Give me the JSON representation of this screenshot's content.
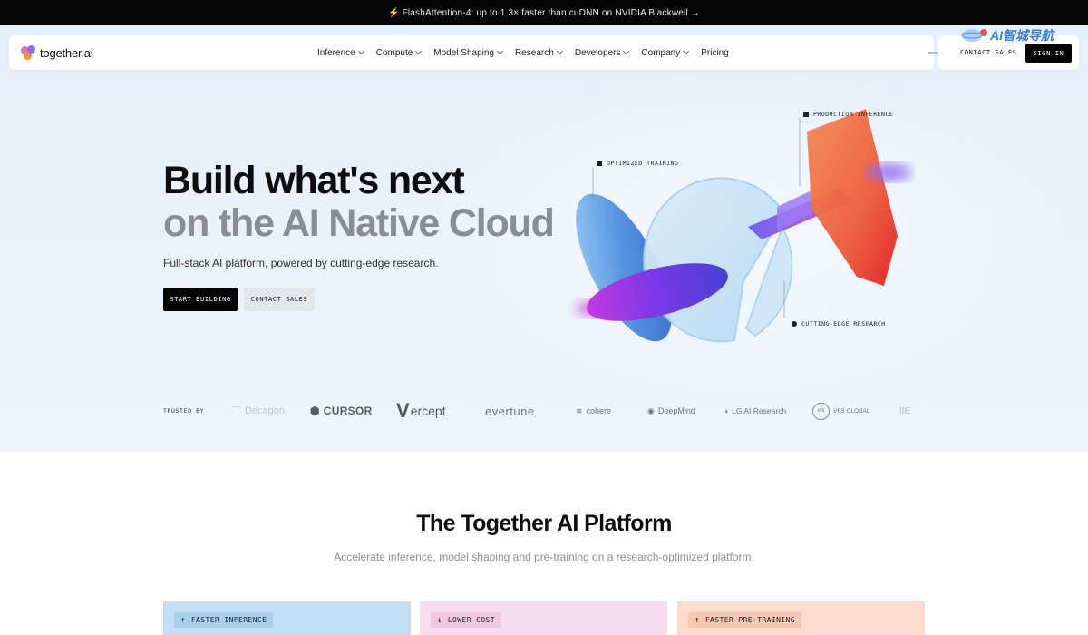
{
  "announcement": {
    "text": "⚡ FlashAttention-4: up to 1.3× faster than cuDNN on NVIDIA Blackwell →"
  },
  "brand": {
    "name": "together.ai"
  },
  "nav": {
    "items": [
      {
        "label": "Inference",
        "dropdown": true
      },
      {
        "label": "Compute",
        "dropdown": true
      },
      {
        "label": "Model Shaping",
        "dropdown": true
      },
      {
        "label": "Research",
        "dropdown": true
      },
      {
        "label": "Developers",
        "dropdown": true
      },
      {
        "label": "Company",
        "dropdown": true
      },
      {
        "label": "Pricing",
        "dropdown": false
      }
    ],
    "contact_label": "CONTACT SALES",
    "signin_label": "SIGN IN"
  },
  "watermark": {
    "text": "AI智城导航"
  },
  "hero": {
    "title_line1": "Build what's next",
    "title_line2": "on the AI Native Cloud",
    "subtitle": "Full-stack AI platform, powered by cutting-edge research.",
    "primary_cta": "START BUILDING",
    "secondary_cta": "CONTACT SALES",
    "labels": {
      "training": "OPTIMIZED TRAINING",
      "inference": "PRODUCTION INFERENCE",
      "research": "CUTTING-EDGE RESEARCH"
    }
  },
  "trusted": {
    "label": "TRUSTED BY",
    "logos": [
      "Decagon",
      "CURSOR",
      "ercept",
      "evertune",
      "cohere",
      "DeepMind",
      "LG AI Research",
      "VFS GLOBAL",
      "IIE"
    ]
  },
  "platform": {
    "title": "The Together AI Platform",
    "subtitle": "Accelerate inference, model shaping and pre-training on a research-optimized platform.",
    "cards": [
      {
        "label": "FASTER INFERENCE",
        "arrow": "↑",
        "bg": "#c2dff5",
        "pill": "#a9cfee"
      },
      {
        "label": "LOWER COST",
        "arrow": "↓",
        "bg": "#f8dcef",
        "pill": "#f1c7e4"
      },
      {
        "label": "FASTER PRE-TRAINING",
        "arrow": "↑",
        "bg": "#fbdccd",
        "pill": "#f6c8b3"
      }
    ]
  },
  "colors": {
    "accent": "#050505",
    "muted": "#8a8e93",
    "hero_bg": "#e6f0fa"
  }
}
